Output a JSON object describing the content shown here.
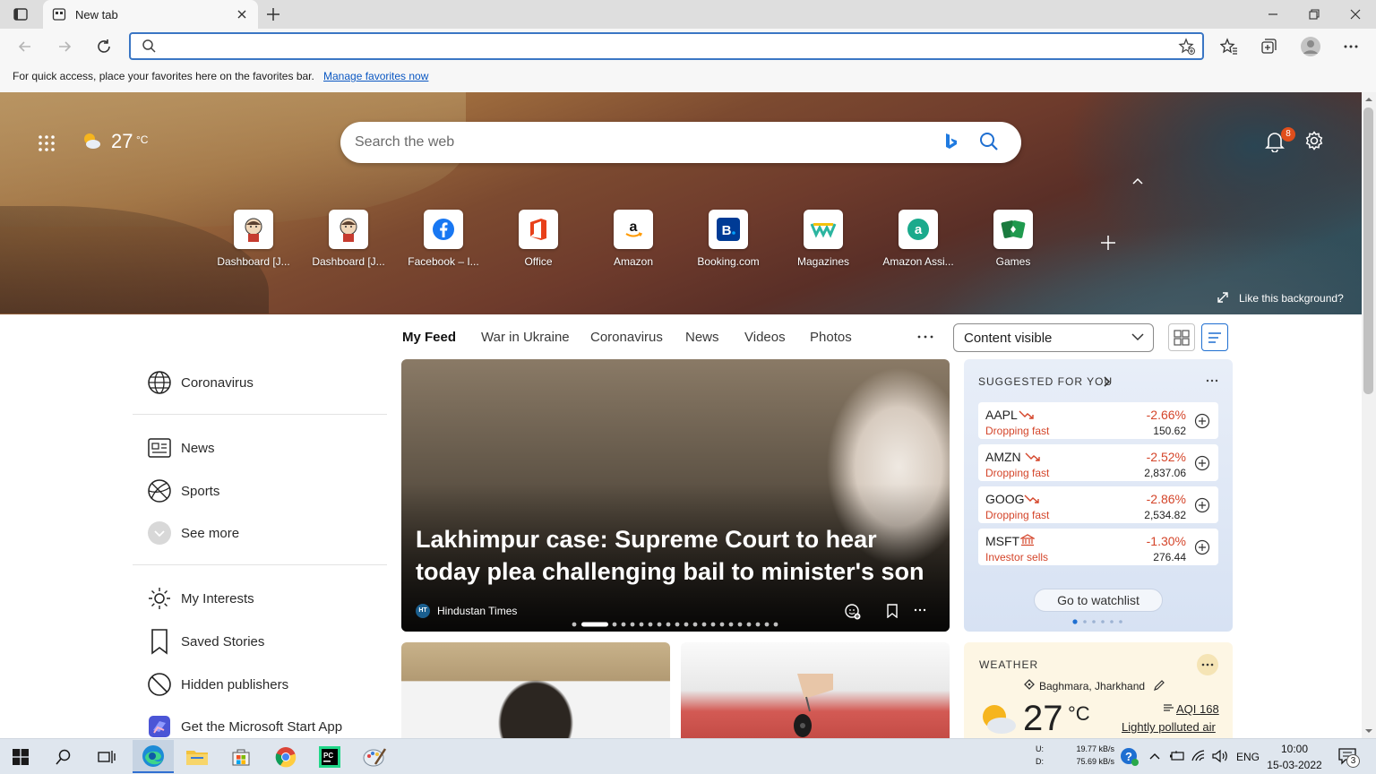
{
  "browser": {
    "tab_title": "New tab",
    "favorites_bar_text": "For quick access, place your favorites here on the favorites bar.",
    "favorites_bar_link": "Manage favorites now"
  },
  "hero": {
    "weather_temp": "27",
    "weather_unit": "°C",
    "search_placeholder": "Search the web",
    "notification_count": "8",
    "like_background": "Like this background?",
    "quick_links": [
      {
        "label": "Dashboard [J...",
        "icon": "jenkins-icon"
      },
      {
        "label": "Dashboard [J...",
        "icon": "jenkins-icon"
      },
      {
        "label": "Facebook – I...",
        "icon": "facebook-icon"
      },
      {
        "label": "Office",
        "icon": "office-icon"
      },
      {
        "label": "Amazon",
        "icon": "amazon-icon"
      },
      {
        "label": "Booking.com",
        "icon": "booking-icon"
      },
      {
        "label": "Magazines",
        "icon": "magazines-icon"
      },
      {
        "label": "Amazon Assi...",
        "icon": "amazon-assistant-icon"
      },
      {
        "label": "Games",
        "icon": "games-icon"
      }
    ]
  },
  "feed": {
    "tabs": [
      "My Feed",
      "War in Ukraine",
      "Coronavirus",
      "News",
      "Videos",
      "Photos"
    ],
    "content_select": "Content visible"
  },
  "sidebar": {
    "items": [
      {
        "label": "Coronavirus",
        "icon": "globe-icon"
      },
      {
        "label": "News",
        "icon": "news-icon"
      },
      {
        "label": "Sports",
        "icon": "sports-icon"
      },
      {
        "label": "See more",
        "icon": "chevron-down-icon"
      },
      {
        "label": "My Interests",
        "icon": "sun-icon"
      },
      {
        "label": "Saved Stories",
        "icon": "bookmark-icon"
      },
      {
        "label": "Hidden publishers",
        "icon": "block-icon"
      },
      {
        "label": "Get the Microsoft Start App",
        "icon": "microsoft-start-icon"
      }
    ]
  },
  "main_story": {
    "headline": "Lakhimpur case: Supreme Court to hear today plea challenging bail to minister's son",
    "source": "Hindustan Times",
    "source_badge": "HT"
  },
  "markets": {
    "title": "SUGGESTED FOR YOU",
    "stocks": [
      {
        "symbol": "AAPL",
        "note": "Dropping fast",
        "change": "-2.66%",
        "price": "150.62"
      },
      {
        "symbol": "AMZN",
        "note": "Dropping fast",
        "change": "-2.52%",
        "price": "2,837.06"
      },
      {
        "symbol": "GOOG",
        "note": "Dropping fast",
        "change": "-2.86%",
        "price": "2,534.82"
      },
      {
        "symbol": "MSFT",
        "note": "Investor sells",
        "change": "-1.30%",
        "price": "276.44"
      }
    ],
    "watchlist_button": "Go to watchlist"
  },
  "weather": {
    "title": "WEATHER",
    "location": "Baghmara, Jharkhand",
    "temp": "27",
    "unit": "°C",
    "aqi": "AQI 168",
    "aqi_desc": "Lightly polluted air"
  },
  "taskbar": {
    "net_up_label": "U:",
    "net_down_label": "D:",
    "net_up": "19.77 kB/s",
    "net_down": "75.69 kB/s",
    "language": "ENG",
    "time": "10:00",
    "date": "15-03-2022",
    "notification_count": "3"
  }
}
